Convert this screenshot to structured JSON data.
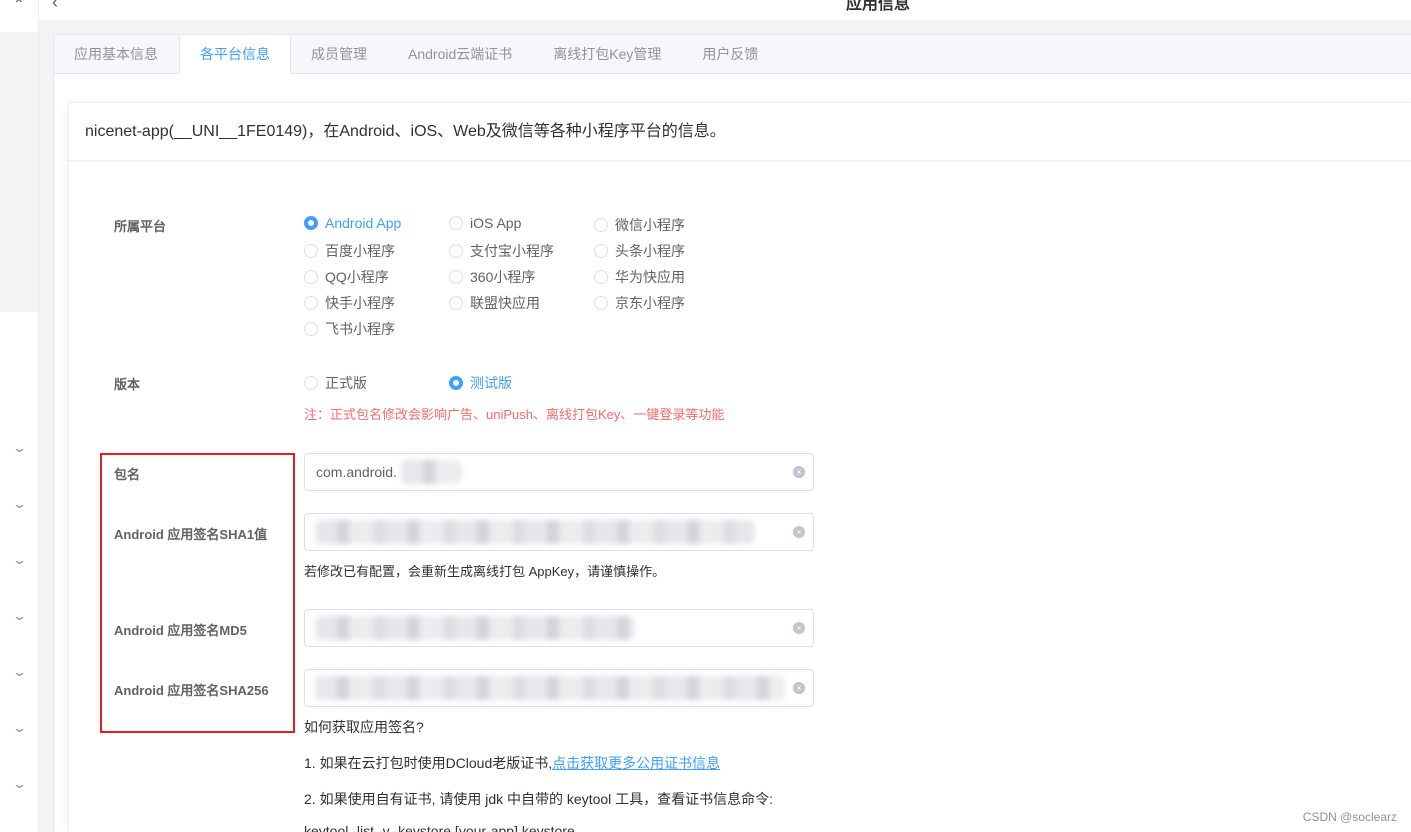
{
  "header": {
    "back_glyph": "‹",
    "title": "应用信息"
  },
  "left_rail": {
    "up_glyph": "⌃",
    "chevron_glyph": "⌄"
  },
  "tabs": [
    {
      "label": "应用基本信息",
      "active": false
    },
    {
      "label": "各平台信息",
      "active": true
    },
    {
      "label": "成员管理",
      "active": false
    },
    {
      "label": "Android云端证书",
      "active": false
    },
    {
      "label": "离线打包Key管理",
      "active": false
    },
    {
      "label": "用户反馈",
      "active": false
    }
  ],
  "card": {
    "title": "nicenet-app(__UNI__1FE0149)，在Android、iOS、Web及微信等各种小程序平台的信息。"
  },
  "platform": {
    "label": "所属平台",
    "options": [
      {
        "label": "Android App",
        "checked": true
      },
      {
        "label": "iOS App",
        "checked": false
      },
      {
        "label": "微信小程序",
        "checked": false
      },
      {
        "label": "百度小程序",
        "checked": false
      },
      {
        "label": "支付宝小程序",
        "checked": false
      },
      {
        "label": "头条小程序",
        "checked": false
      },
      {
        "label": "QQ小程序",
        "checked": false
      },
      {
        "label": "360小程序",
        "checked": false
      },
      {
        "label": "华为快应用",
        "checked": false
      },
      {
        "label": "快手小程序",
        "checked": false
      },
      {
        "label": "联盟快应用",
        "checked": false
      },
      {
        "label": "京东小程序",
        "checked": false
      },
      {
        "label": "飞书小程序",
        "checked": false
      }
    ]
  },
  "version": {
    "label": "版本",
    "options": [
      {
        "label": "正式版",
        "checked": false
      },
      {
        "label": "测试版",
        "checked": true
      }
    ],
    "warning": "注：正式包名修改会影响广告、uniPush、离线打包Key、一键登录等功能"
  },
  "fields": {
    "package_label": "包名",
    "package_value": "com.android.",
    "sha1_label": "Android 应用签名SHA1值",
    "sha1_hint": "若修改已有配置，会重新生成离线打包 AppKey，请谨慎操作。",
    "md5_label": "Android 应用签名MD5",
    "sha256_label": "Android 应用签名SHA256"
  },
  "help": {
    "question": "如何获取应用签名?",
    "step1_prefix": "1. 如果在云打包时使用DCloud老版证书,",
    "step1_link": "点击获取更多公用证书信息",
    "step2": "2. 如果使用自有证书, 请使用 jdk 中自带的 keytool 工具，查看证书信息命令:",
    "command": "keytool -list -v -keystore [your-app].keystore"
  },
  "icons": {
    "clear": "clear-icon",
    "back": "back-arrow-icon"
  },
  "colors": {
    "accent": "#409eff",
    "warning": "#f56c6c",
    "highlight": "#e02020"
  },
  "watermark": "CSDN @soclearz"
}
